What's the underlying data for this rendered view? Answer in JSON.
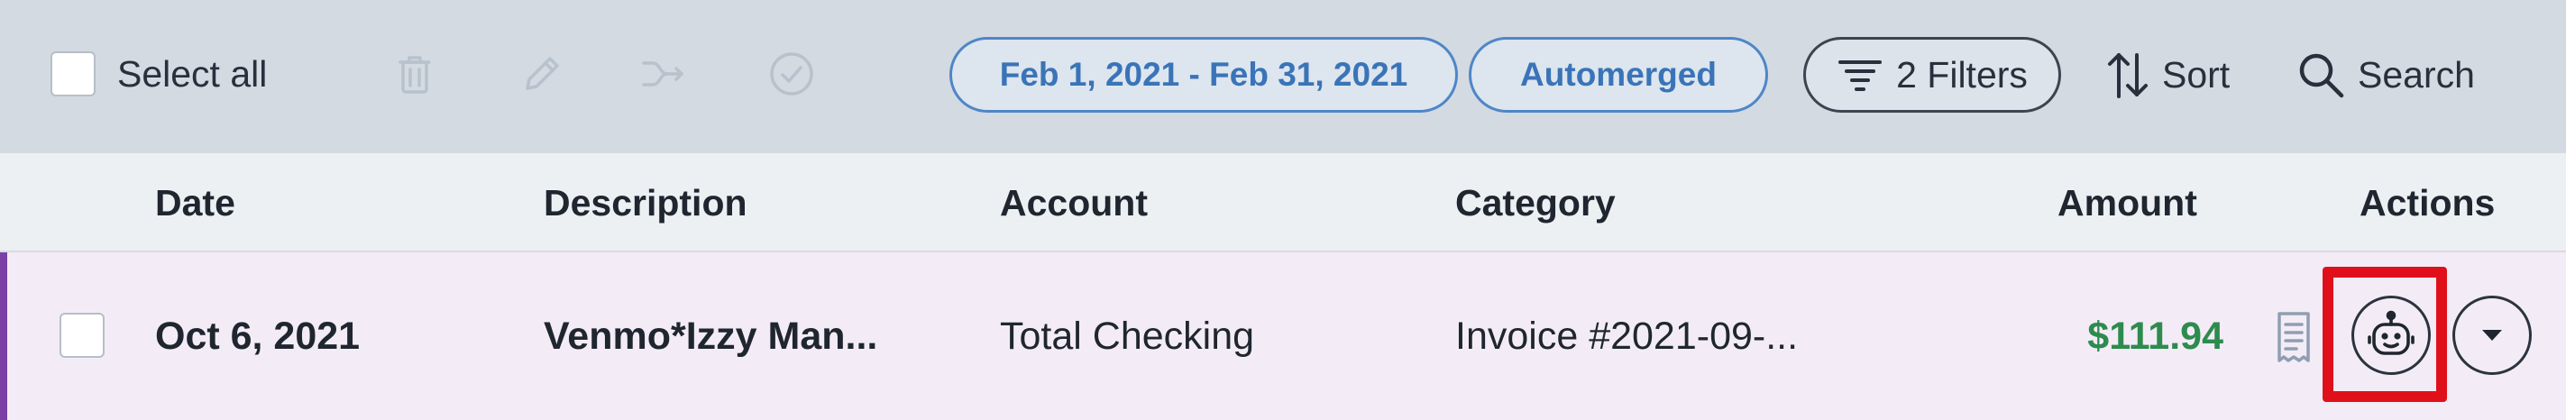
{
  "toolbar": {
    "select_all_label": "Select all",
    "icons": [
      "trash-icon",
      "pencil-icon",
      "merge-icon",
      "check-circle-icon"
    ],
    "date_range": "Feb 1, 2021 - Feb 31, 2021",
    "automerged": "Automerged",
    "filters": "2 Filters",
    "sort": "Sort",
    "search": "Search"
  },
  "table": {
    "headers": {
      "date": "Date",
      "description": "Description",
      "account": "Account",
      "category": "Category",
      "amount": "Amount",
      "actions": "Actions"
    },
    "rows": [
      {
        "date": "Oct 6, 2021",
        "description": "Venmo*Izzy Man...",
        "account": "Total Checking",
        "category": "Invoice #2021-09-...",
        "amount": "$111.94",
        "action_icons": [
          "receipt-icon",
          "robot-icon",
          "chevron-down-icon"
        ]
      }
    ]
  },
  "colors": {
    "toolbar_bg": "#d3dae2",
    "row_accent": "#7b3fa6",
    "amount_positive": "#2e8b4e",
    "pill_blue": "#4f86c6",
    "highlight": "#e0101b"
  }
}
